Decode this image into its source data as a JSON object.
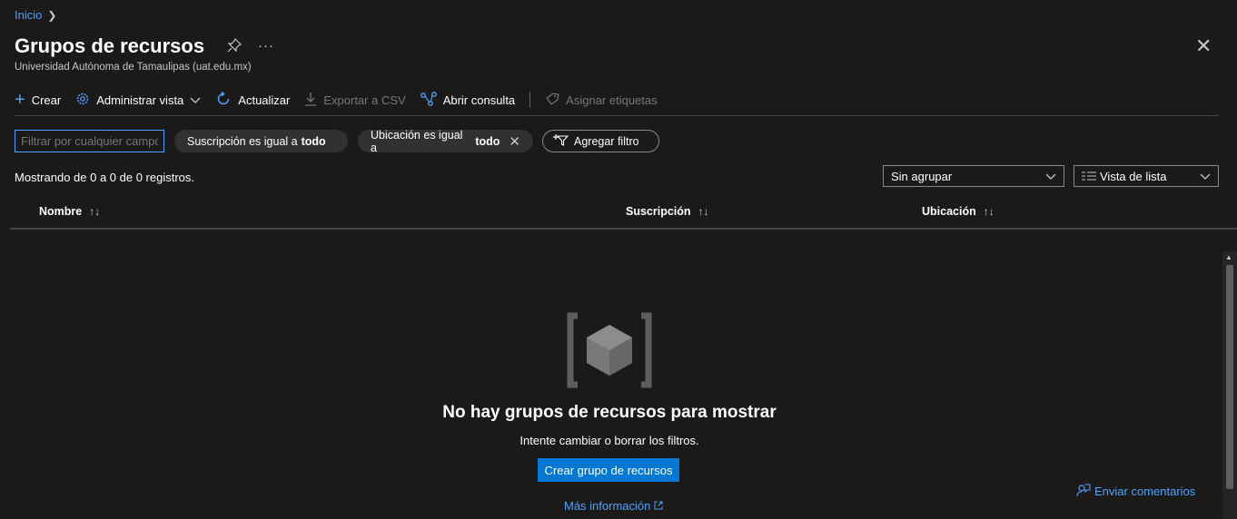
{
  "breadcrumb": {
    "home": "Inicio"
  },
  "page": {
    "title": "Grupos de recursos",
    "subtitle": "Universidad Autónoma de Tamaulipas (uat.edu.mx)"
  },
  "toolbar": {
    "create": "Crear",
    "manage_view": "Administrar vista",
    "refresh": "Actualizar",
    "export_csv": "Exportar a CSV",
    "open_query": "Abrir consulta",
    "assign_tags": "Asignar etiquetas"
  },
  "filters": {
    "search_placeholder": "Filtrar por cualquier campo...",
    "subscription_label": "Suscripción es igual a",
    "subscription_value": "todo",
    "location_label": "Ubicación es igual a",
    "location_value": "todo",
    "add_filter": "Agregar filtro"
  },
  "list": {
    "count_text": "Mostrando de 0 a 0 de 0 registros.",
    "group_by": "Sin agrupar",
    "view_mode": "Vista de lista",
    "columns": [
      "Nombre",
      "Suscripción",
      "Ubicación"
    ]
  },
  "empty_state": {
    "title": "No hay grupos de recursos para mostrar",
    "subtitle": "Intente cambiar o borrar los filtros.",
    "create_button": "Crear grupo de recursos",
    "more_info": "Más información"
  },
  "feedback": {
    "label": "Enviar comentarios"
  },
  "colors": {
    "accent": "#0078d4",
    "link": "#4da3ff",
    "background": "#1b1a19"
  }
}
